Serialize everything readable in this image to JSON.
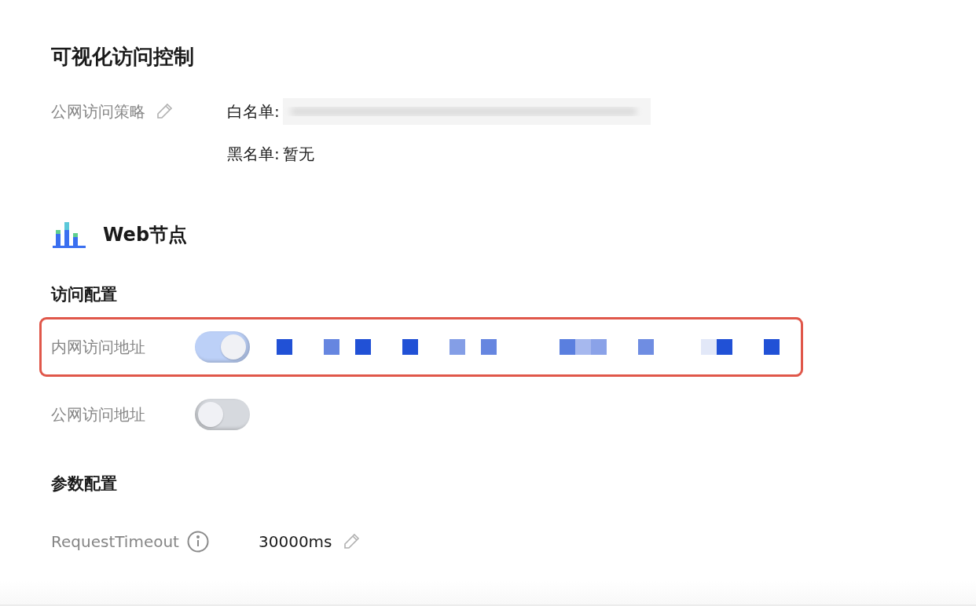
{
  "title": "可视化访问控制",
  "policy": {
    "label": "公网访问策略",
    "whitelist_label": "白名单:",
    "blacklist_label": "黑名单:",
    "blacklist_value": "暂无"
  },
  "section": {
    "title": "Web节点"
  },
  "access_config": {
    "title": "访问配置",
    "rows": [
      {
        "label": "内网访问地址",
        "on": true,
        "highlighted": true
      },
      {
        "label": "公网访问地址",
        "on": false,
        "highlighted": false
      }
    ]
  },
  "param_config": {
    "title": "参数配置",
    "params": [
      {
        "label": "RequestTimeout",
        "value": "30000ms"
      }
    ]
  }
}
